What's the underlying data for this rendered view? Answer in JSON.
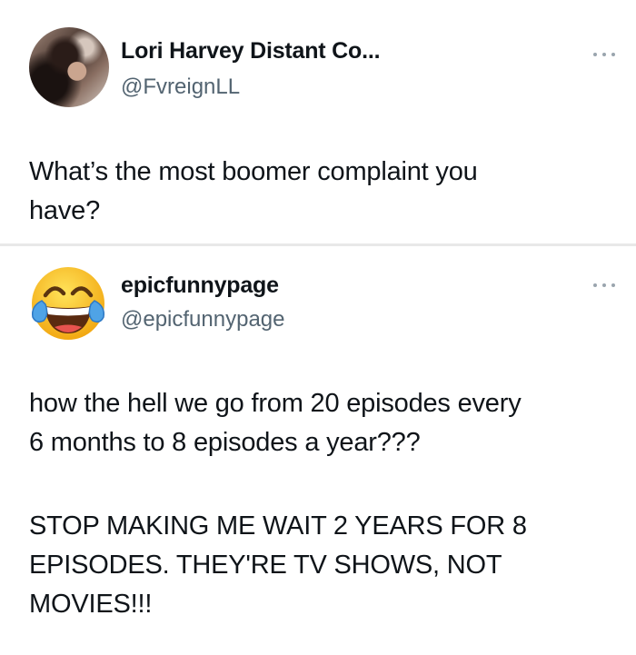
{
  "tweets": [
    {
      "author": {
        "name": "Lori Harvey Distant Co...",
        "handle": "@FvreignLL",
        "avatar": "profile-photo"
      },
      "more_icon": "more-dots-icon",
      "text": "What’s the most boomer complaint you\nhave?"
    },
    {
      "author": {
        "name": "epicfunnypage",
        "handle": "@epicfunnypage",
        "avatar": "tears-of-joy-emoji"
      },
      "more_icon": "more-dots-icon",
      "paragraphs": [
        "how the hell we go from 20 episodes every\n6 months to 8 episodes a year???",
        "STOP MAKING ME WAIT 2 YEARS FOR 8\nEPISODES. THEY'RE TV SHOWS, NOT\nMOVIES!!!"
      ]
    }
  ],
  "colors": {
    "text": "#0f1419",
    "secondary_text": "#536471",
    "divider": "#e8e8e8",
    "emoji_face": "#f8c21c",
    "emoji_tears": "#4fa3e6"
  }
}
